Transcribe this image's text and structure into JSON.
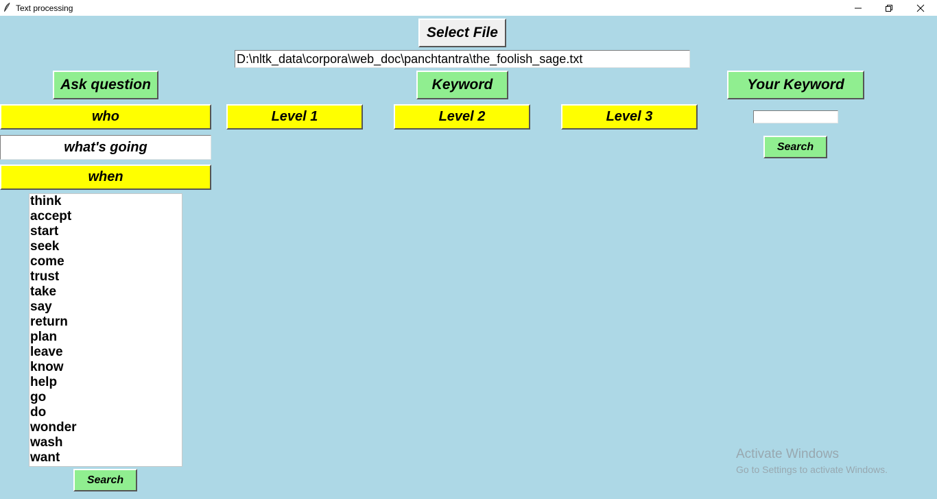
{
  "window": {
    "title": "Text processing"
  },
  "toolbar": {
    "select_file_label": "Select File",
    "file_path": "D:\\nltk_data\\corpora\\web_doc\\panchtantra\\the_foolish_sage.txt"
  },
  "buttons": {
    "ask_question": "Ask question",
    "keyword": "Keyword",
    "your_keyword": "Your Keyword",
    "who": "who",
    "level1": "Level 1",
    "level2": "Level 2",
    "level3": "Level 3",
    "when": "when",
    "search_keyword": "Search",
    "search_bottom": "Search"
  },
  "fields": {
    "whats_going_value": "what's going",
    "keyword_value": ""
  },
  "verbs": [
    "think",
    "accept",
    "start",
    "seek",
    "come",
    "trust",
    "take",
    "say",
    "return",
    "plan",
    "leave",
    "know",
    "help",
    "go",
    "do",
    "wonder",
    "wash",
    "want"
  ],
  "watermark": {
    "line1": "Activate Windows",
    "line2": "Go to Settings to activate Windows."
  },
  "colors": {
    "background": "#add8e6",
    "green_button": "#90ee90",
    "yellow_button": "#ffff00",
    "grey_button": "#f0f0f0"
  },
  "icons": [
    "feather-app-icon",
    "minimize-icon",
    "restore-icon",
    "close-icon"
  ]
}
